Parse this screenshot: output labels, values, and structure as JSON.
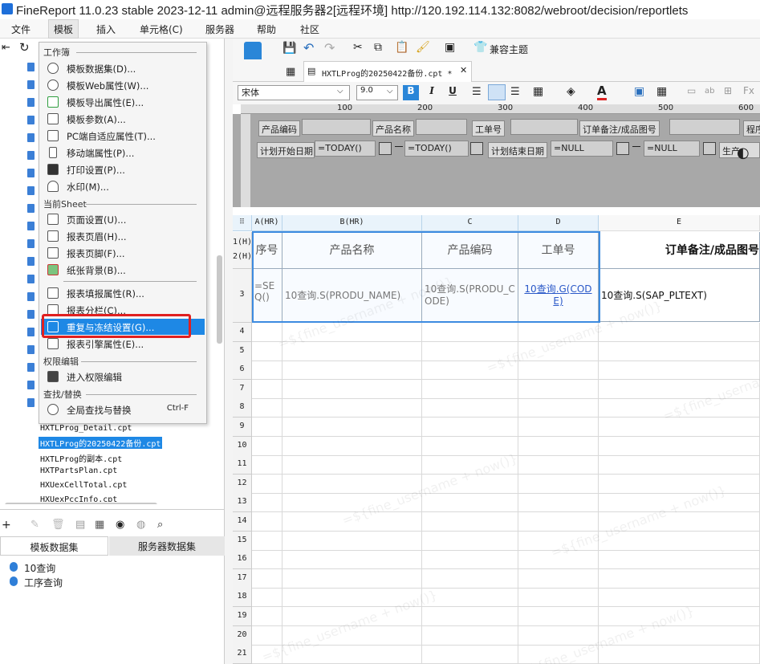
{
  "titlebar": {
    "title": "FineReport 11.0.23 stable 2023-12-11 admin@远程服务器2[远程环境]    http://120.192.114.132:8082/webroot/decision/reportlets"
  },
  "menubar": {
    "items": [
      "文件",
      "模板",
      "插入",
      "单元格(C)",
      "服务器",
      "帮助",
      "社区"
    ]
  },
  "template_menu": {
    "sections": {
      "workbook": "工作簿",
      "current_sheet": "当前Sheet",
      "permission": "权限编辑",
      "find": "查找/替换"
    },
    "items": [
      {
        "label": "模板数据集(D)..."
      },
      {
        "label": "模板Web属性(W)..."
      },
      {
        "label": "模板导出属性(E)..."
      },
      {
        "label": "模板参数(A)..."
      },
      {
        "label": "PC端自适应属性(T)..."
      },
      {
        "label": "移动端属性(P)..."
      },
      {
        "label": "打印设置(P)..."
      },
      {
        "label": "水印(M)..."
      },
      {
        "label": "页面设置(U)..."
      },
      {
        "label": "报表页眉(H)..."
      },
      {
        "label": "报表页脚(F)..."
      },
      {
        "label": "纸张背景(B)..."
      },
      {
        "label": "报表填报属性(R)..."
      },
      {
        "label": "报表分栏(C)..."
      },
      {
        "label": "重复与冻结设置(G)..."
      },
      {
        "label": "报表引擎属性(E)..."
      },
      {
        "label": "进入权限编辑"
      },
      {
        "label": "全局查找与替换",
        "shortcut": "Ctrl-F"
      }
    ]
  },
  "file_tree": {
    "items": [
      {
        "label": "HXTLProg_Detail.cpt"
      },
      {
        "label": "HXTLProg的20250422备份.cpt",
        "selected": true
      },
      {
        "label": "HXTLProg的副本.cpt"
      },
      {
        "label": "HXTPartsPlan.cpt"
      },
      {
        "label": "HXUexCellTotal.cpt"
      },
      {
        "label": "HXUexPccInfo.cpt"
      }
    ]
  },
  "datasets": {
    "tabs": [
      "模板数据集",
      "服务器数据集"
    ],
    "items": [
      "10查询",
      "工序查询"
    ]
  },
  "toolbar": {
    "compat_theme": "兼容主题",
    "font": "宋体",
    "font_size": "9.0",
    "bold": "B",
    "italic": "I",
    "underline": "U"
  },
  "editor_tab": {
    "label": "HXTLProg的20250422备份.cpt *"
  },
  "ruler": {
    "marks": [
      "100",
      "200",
      "300",
      "400",
      "500",
      "600"
    ]
  },
  "params": {
    "row1": [
      {
        "label": "产品编码"
      },
      {
        "label": "产品名称"
      },
      {
        "label": "工单号"
      },
      {
        "label": "订单备注/成品图号"
      },
      {
        "label": "程序"
      }
    ],
    "row2": [
      {
        "label": "计划开始日期",
        "value": "=TODAY()"
      },
      {
        "label": "",
        "value": "=TODAY()"
      },
      {
        "label": "计划结束日期",
        "value": "=NULL"
      },
      {
        "label": "",
        "value": "=NULL"
      },
      {
        "label": "生产"
      }
    ]
  },
  "sheet": {
    "columns": [
      "A(HR)",
      "B(HR)",
      "C",
      "D",
      "E"
    ],
    "header_row_labels": [
      "1(H)",
      "2(H)"
    ],
    "headers": [
      "序号",
      "产品名称",
      "产品编码",
      "工单号",
      "订单备注/成品图号"
    ],
    "data_row_label": "3",
    "data_cells": [
      "=SEQ()",
      "10查询.S(PRODU_NAME)",
      "10查询.S(PRODU_CODE)",
      "10查询.G(CODE)",
      "10查询.S(SAP_PLTEXT)"
    ],
    "empty_rows": [
      "4",
      "5",
      "6",
      "7",
      "8",
      "9",
      "10",
      "11",
      "12",
      "13",
      "14",
      "15",
      "16",
      "17",
      "18",
      "19",
      "20",
      "21"
    ],
    "watermark": "=${fine_username + now()}"
  }
}
